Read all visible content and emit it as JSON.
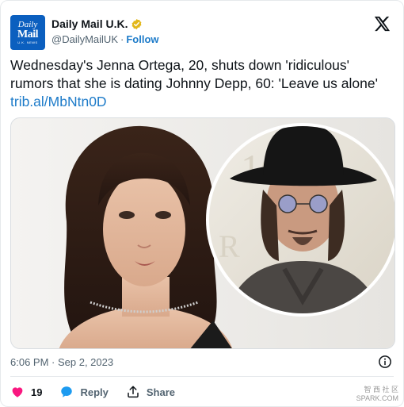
{
  "account": {
    "display_name": "Daily Mail U.K.",
    "handle": "@DailyMailUK",
    "separator": "·",
    "follow_label": "Follow",
    "avatar_line1": "Daily",
    "avatar_line2": "Mail",
    "avatar_line3": "U.K. NEWS",
    "avatar_color": "#0b5fbf",
    "verified_badge_color": "#e2b719"
  },
  "tweet": {
    "text": "Wednesday's Jenna Ortega, 20, shuts down 'ridiculous' rumors that she is dating Johnny Depp, 60: 'Leave us alone'",
    "link": "trib.al/MbNtn0D",
    "timestamp": "6:06 PM · Sep 2, 2023"
  },
  "actions": {
    "like_count": "19",
    "reply_label": "Reply",
    "share_label": "Share",
    "like_color": "#f91880",
    "reply_color": "#1d9bf0"
  },
  "watermark": {
    "line1": "智 西 社 区",
    "line2": "SPARK.COM"
  },
  "icons": {
    "brand": "x-logo-icon",
    "info": "info-icon",
    "like": "heart-icon",
    "reply": "speech-bubble-icon",
    "share": "share-upload-icon"
  }
}
